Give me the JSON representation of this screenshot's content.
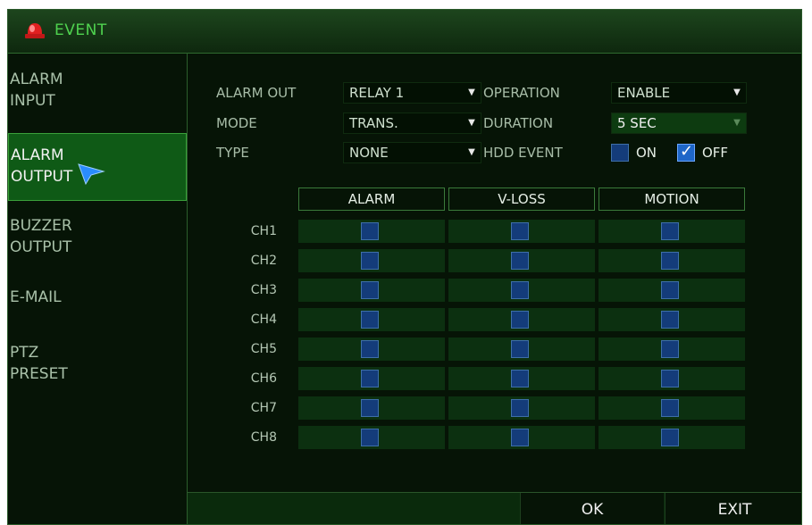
{
  "window": {
    "title": "EVENT",
    "icon": "alarm-light-icon"
  },
  "sidebar": {
    "items": [
      {
        "line1": "ALARM",
        "line2": "INPUT"
      },
      {
        "line1": "ALARM",
        "line2": "OUTPUT"
      },
      {
        "line1": "BUZZER",
        "line2": "OUTPUT"
      },
      {
        "line1": "E-MAIL",
        "line2": ""
      },
      {
        "line1": "PTZ",
        "line2": "PRESET"
      }
    ],
    "active_index": 1
  },
  "settings": {
    "alarm_out": {
      "label": "ALARM OUT",
      "value": "RELAY 1"
    },
    "mode": {
      "label": "MODE",
      "value": "TRANS."
    },
    "type": {
      "label": "TYPE",
      "value": "NONE"
    },
    "operation": {
      "label": "OPERATION",
      "value": "ENABLE"
    },
    "duration": {
      "label": "DURATION",
      "value": "5 SEC"
    },
    "hdd_event": {
      "label": "HDD EVENT",
      "on_label": "ON",
      "off_label": "OFF",
      "selected": "OFF"
    }
  },
  "table": {
    "columns": [
      "ALARM",
      "V-LOSS",
      "MOTION"
    ],
    "rows": [
      "CH1",
      "CH2",
      "CH3",
      "CH4",
      "CH5",
      "CH6",
      "CH7",
      "CH8"
    ]
  },
  "buttons": {
    "ok": "OK",
    "exit": "EXIT"
  },
  "colors": {
    "background": "#061406",
    "accent": "#4fd24f",
    "active_item": "#0f5a16",
    "checkbox": "#143c7a"
  }
}
